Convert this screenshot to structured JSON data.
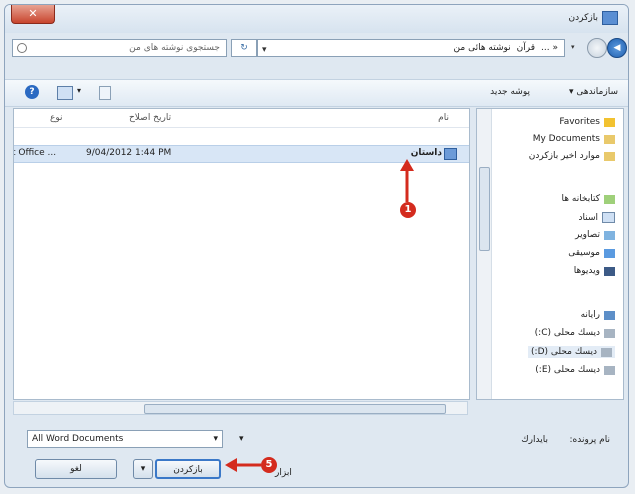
{
  "titlebar": {
    "title": "بازکردن",
    "close_label": "✕"
  },
  "address": {
    "segments": [
      "نوشته هائى من",
      "قرآن",
      "« ..."
    ],
    "search_placeholder": "جستجوى نوشته هاى من",
    "refresh_symbol": "↻",
    "back_symbol": "◀"
  },
  "toolbar": {
    "organize": "سازماندهى ▾",
    "new_folder": "پوشه جديد"
  },
  "columns": {
    "name": "نام",
    "date": "تاريخ اصلاح",
    "type": "نوع"
  },
  "file_row": {
    "name": "داستان",
    "date": "9/04/2012 1:44 PM",
    "type": "t Office ..."
  },
  "nav": {
    "favorites": "Favorites",
    "my_documents": "My Documents",
    "recent": "موارد اخير بازكردن",
    "libraries": "كتابخانه ها",
    "documents": "اسناد",
    "pictures": "تصاوير",
    "music": "موسيقى",
    "videos": "ويديوها",
    "computer": "رايانه",
    "drive_c": "ديسك محلى (C:)",
    "drive_d": "ديسك محلى (D:)",
    "drive_e": "ديسك محلى (E:)"
  },
  "bottom": {
    "filename_label": "نام پرونده:",
    "filename_value": "بايدارك",
    "filetype": "All Word Documents",
    "tools_label": "ابزار",
    "open_button": "بازكردن",
    "cancel_button": "لغو"
  },
  "markers": {
    "step1": "1",
    "step2": "5"
  },
  "colors": {
    "accent": "#3a78c8",
    "marker": "#d42b1e"
  }
}
